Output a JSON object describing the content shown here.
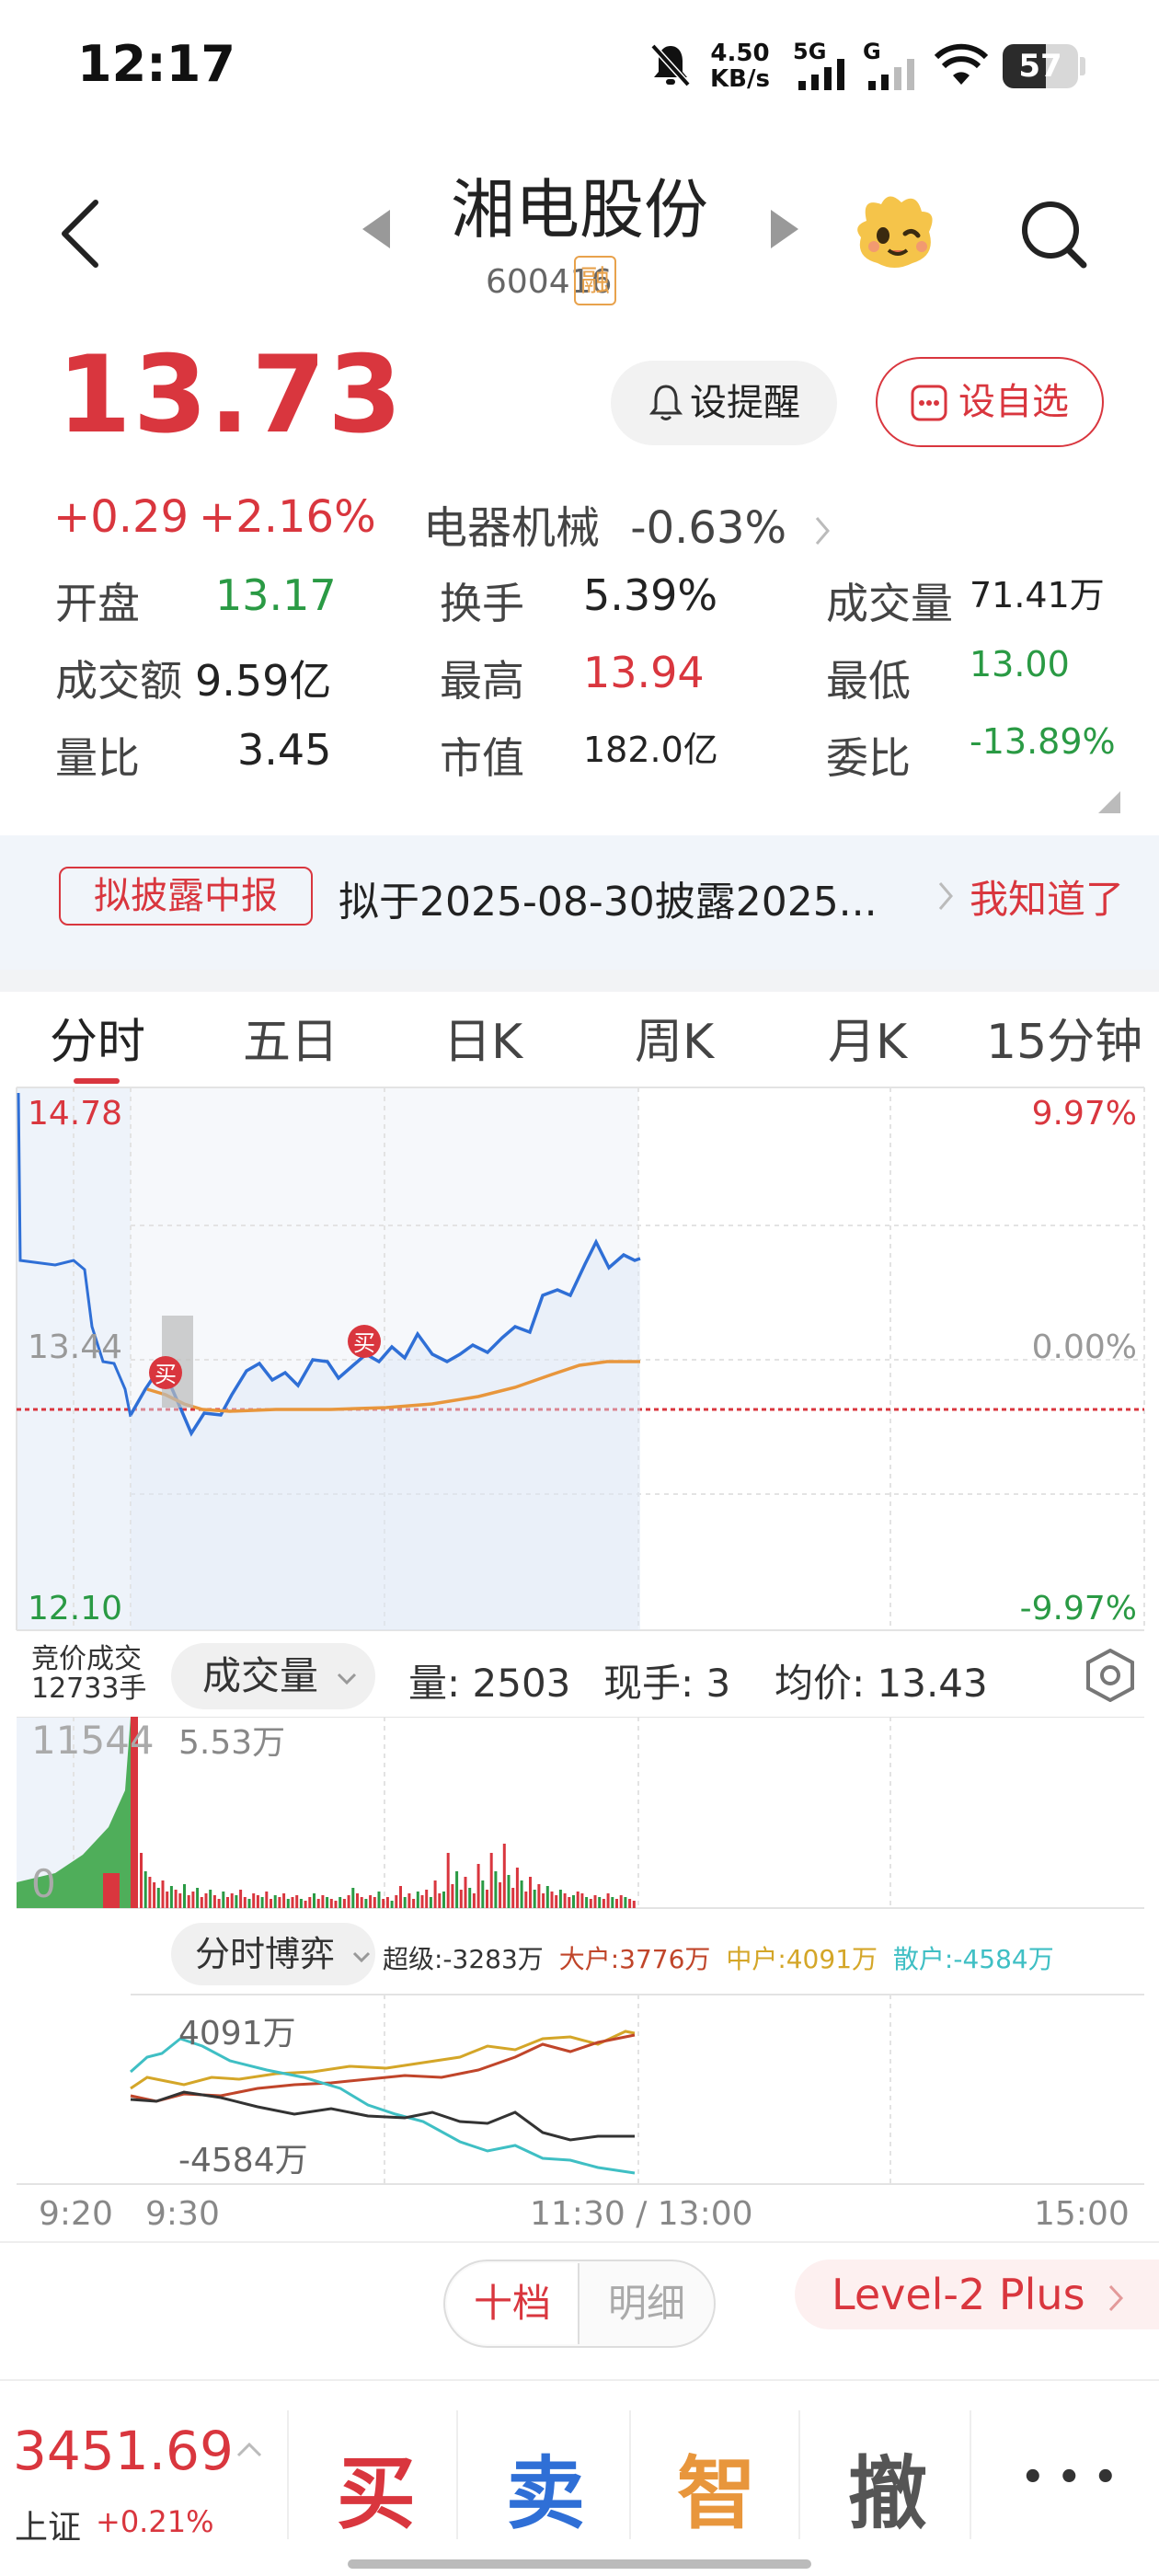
{
  "status_bar": {
    "time": "12:17",
    "speed_value": "4.50",
    "speed_unit": "KB/s",
    "net1": "5G",
    "net2": "G",
    "battery": "57",
    "battery_pct": 57
  },
  "header": {
    "title": "湘电股份",
    "code": "600416",
    "margin_badge": "融"
  },
  "quote": {
    "price": "13.73",
    "change": "+0.29",
    "change_pct": "+2.16%",
    "sector_name": "电器机械",
    "sector_change": "-0.63%",
    "alert_button": "设提醒",
    "watch_button": "设自选",
    "stats": [
      {
        "label": "开盘",
        "value": "13.17",
        "color": "green"
      },
      {
        "label": "换手",
        "value": "5.39%",
        "color": "dark"
      },
      {
        "label": "成交量",
        "value": "71.41万",
        "color": "dark"
      },
      {
        "label": "成交额",
        "value": "9.59亿",
        "color": "dark"
      },
      {
        "label": "最高",
        "value": "13.94",
        "color": "red"
      },
      {
        "label": "最低",
        "value": "13.00",
        "color": "green"
      },
      {
        "label": "量比",
        "value": "3.45",
        "color": "dark"
      },
      {
        "label": "市值",
        "value": "182.0亿",
        "color": "dark"
      },
      {
        "label": "委比",
        "value": "-13.89%",
        "color": "green"
      }
    ]
  },
  "notice": {
    "tag": "拟披露中报",
    "text": "拟于2025-08-30披露2025...",
    "action": "我知道了"
  },
  "tabs": [
    "分时",
    "五日",
    "日K",
    "周K",
    "月K",
    "15分钟"
  ],
  "intraday": {
    "y_top": "14.78",
    "y_mid": "13.44",
    "y_bottom": "12.10",
    "pct_top": "9.97%",
    "pct_mid": "0.00%",
    "pct_bottom": "-9.97%",
    "buy_marker": "买"
  },
  "volume": {
    "auction_label": "竞价成交",
    "auction_value": "12733手",
    "selector": "成交量",
    "qty": "量: 2503",
    "now_hand": "现手: 3",
    "avg_price": "均价: 13.43",
    "y_top": "11544",
    "y_right": "5.53万",
    "y_zero": "0"
  },
  "game": {
    "selector": "分时博弈",
    "super": "超级:-3283万",
    "big": "大户:3776万",
    "mid": "中户:4091万",
    "retail": "散户:-4584万",
    "top_label": "4091万",
    "bottom_label": "-4584万"
  },
  "time_axis": [
    "9:20",
    "9:30",
    "11:30 / 13:00",
    "15:00"
  ],
  "orderbook": {
    "tab1": "十档",
    "tab2": "明细",
    "level2": "Level-2 Plus"
  },
  "bottom": {
    "index_value": "3451.69",
    "index_name": "上证",
    "index_change": "+0.21%",
    "buy": "买",
    "sell": "卖",
    "smart": "智",
    "cancel": "撤",
    "more": "• • •"
  },
  "colors": {
    "red": "#d9363e",
    "green": "#2a9a44",
    "blue": "#2f6fd6",
    "orange": "#e8963c"
  }
}
